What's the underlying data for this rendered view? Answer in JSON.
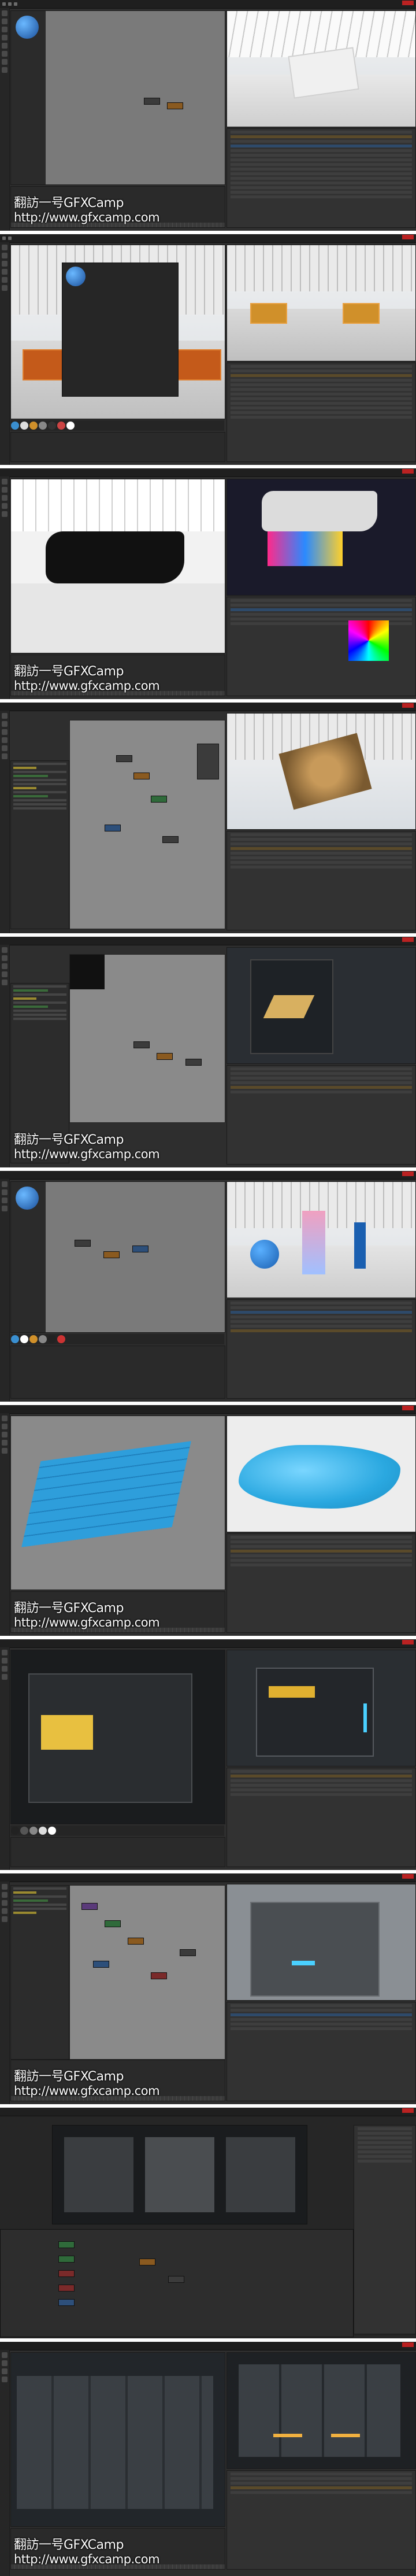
{
  "watermark": {
    "line1": "翻訪一号GFXCamp",
    "line2": "http://www.gfxcamp.com"
  },
  "colors": {
    "ui_dark": "#2e2e2e",
    "viewport_gray": "#6a6a6a",
    "accent_orange": "#d0902a",
    "accent_blue": "#3aa6e0",
    "material_blue": "#3a8fd0",
    "terrain_blue": "#3ab8e8"
  },
  "frames": [
    {
      "scene": "white-gallery-boombox"
    },
    {
      "scene": "gallery-orange-boombox"
    },
    {
      "scene": "black-ship-neon-room"
    },
    {
      "scene": "node-editor-boombox-render"
    },
    {
      "scene": "node-editor-scifi-panel"
    },
    {
      "scene": "gallery-blue-sphere"
    },
    {
      "scene": "terrain-displacement"
    },
    {
      "scene": "scifi-hazard-panel"
    },
    {
      "scene": "node-editor-rusty-cabinet"
    },
    {
      "scene": "compositing-nodes"
    },
    {
      "scene": "scifi-cabinets-lit"
    }
  ]
}
